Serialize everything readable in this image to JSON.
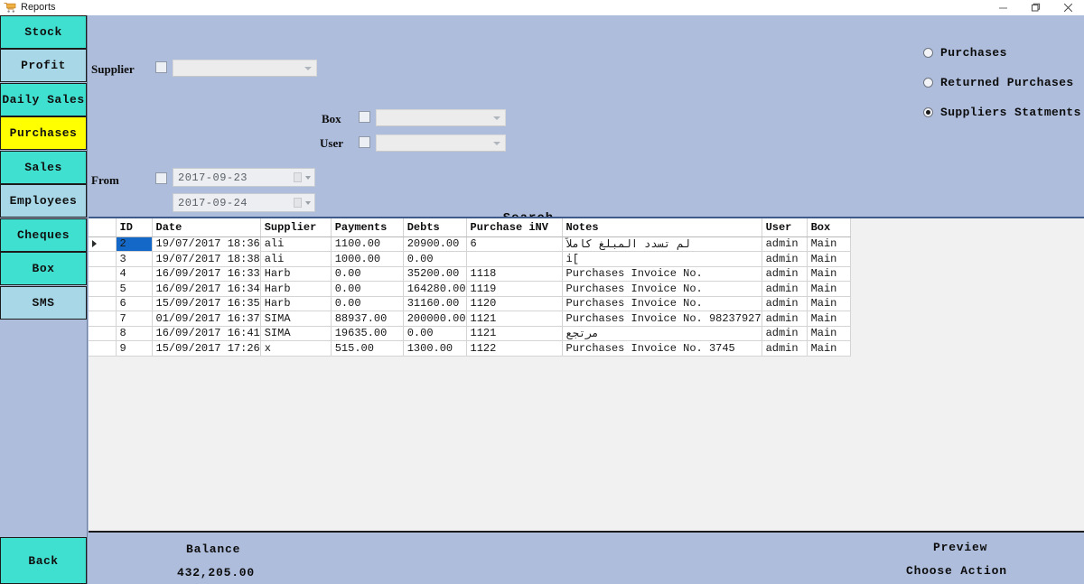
{
  "window": {
    "title": "Reports",
    "icon": "cart-icon",
    "minimize_label": "─",
    "maximize_label": "❐",
    "close_label": "✕"
  },
  "theme": {
    "form_background": "#aebddc",
    "sidebar_teal": "#40e0d0",
    "sidebar_light_blue": "#a8d8e8",
    "sidebar_active_yellow": "#ffff00",
    "grid_selection_blue": "#1468c8",
    "grid_panel_background": "#f1f1f1"
  },
  "sidebar": {
    "items": [
      {
        "label": "Stock",
        "style": "teal",
        "active": false
      },
      {
        "label": "Profit",
        "style": "light",
        "active": false
      },
      {
        "label": "Daily Sales",
        "style": "teal",
        "active": false
      },
      {
        "label": "Purchases",
        "style": "active",
        "active": true
      },
      {
        "label": "Sales",
        "style": "teal",
        "active": false
      },
      {
        "label": "Employees",
        "style": "light",
        "active": false
      },
      {
        "label": "Cheques",
        "style": "teal",
        "active": false
      },
      {
        "label": "Box",
        "style": "teal",
        "active": false
      },
      {
        "label": "SMS",
        "style": "light",
        "active": false
      }
    ],
    "back_label": "Back"
  },
  "filters": {
    "supplier": {
      "label": "Supplier",
      "checked": false,
      "value": "",
      "placeholder": ""
    },
    "box": {
      "label": "Box",
      "checked": false,
      "value": "",
      "placeholder": ""
    },
    "user": {
      "label": "User",
      "checked": false,
      "value": "",
      "placeholder": ""
    },
    "from": {
      "label": "From",
      "checked": false,
      "date_from": "2017-09-23",
      "date_to": "2017-09-24"
    },
    "search_label": "Search"
  },
  "report_type": {
    "options": [
      {
        "label": "Purchases",
        "selected": false
      },
      {
        "label": "Returned Purchases",
        "selected": false
      },
      {
        "label": "Suppliers Statments",
        "selected": true
      }
    ]
  },
  "grid": {
    "columns": [
      "ID",
      "Date",
      "Supplier",
      "Payments",
      "Debts",
      "Purchase iNV",
      "Notes",
      "User",
      "Box"
    ],
    "selected_row_index": 0,
    "rows": [
      {
        "id": "2",
        "date": "19/07/2017 18:36",
        "supplier": "ali",
        "payments": "1100.00",
        "debts": "20900.00",
        "purchase_inv": "6",
        "notes": "لم تسدد المبلغ كاملاً",
        "notes_rtl": true,
        "user": "admin",
        "box": "Main"
      },
      {
        "id": "3",
        "date": "19/07/2017 18:38",
        "supplier": "ali",
        "payments": "1000.00",
        "debts": "0.00",
        "purchase_inv": "",
        "notes": "i[",
        "notes_rtl": false,
        "user": "admin",
        "box": "Main"
      },
      {
        "id": "4",
        "date": "16/09/2017 16:33",
        "supplier": "Harb",
        "payments": "0.00",
        "debts": "35200.00",
        "purchase_inv": "1118",
        "notes": "Purchases Invoice No.",
        "notes_rtl": false,
        "user": "admin",
        "box": "Main"
      },
      {
        "id": "5",
        "date": "16/09/2017 16:34",
        "supplier": "Harb",
        "payments": "0.00",
        "debts": "164280.00",
        "purchase_inv": "1119",
        "notes": "Purchases Invoice No.",
        "notes_rtl": false,
        "user": "admin",
        "box": "Main"
      },
      {
        "id": "6",
        "date": "15/09/2017 16:35",
        "supplier": "Harb",
        "payments": "0.00",
        "debts": "31160.00",
        "purchase_inv": "1120",
        "notes": "Purchases Invoice No.",
        "notes_rtl": false,
        "user": "admin",
        "box": "Main"
      },
      {
        "id": "7",
        "date": "01/09/2017 16:37",
        "supplier": "SIMA",
        "payments": "88937.00",
        "debts": "200000.00",
        "purchase_inv": "1121",
        "notes": "Purchases Invoice No. 98237927",
        "notes_rtl": false,
        "user": "admin",
        "box": "Main"
      },
      {
        "id": "8",
        "date": "16/09/2017 16:41",
        "supplier": "SIMA",
        "payments": "19635.00",
        "debts": "0.00",
        "purchase_inv": "1121",
        "notes": "مرتجع",
        "notes_rtl": true,
        "user": "admin",
        "box": "Main"
      },
      {
        "id": "9",
        "date": "15/09/2017 17:26",
        "supplier": "x",
        "payments": "515.00",
        "debts": "1300.00",
        "purchase_inv": "1122",
        "notes": "Purchases Invoice No. 3745",
        "notes_rtl": false,
        "user": "admin",
        "box": "Main"
      }
    ]
  },
  "footer": {
    "balance_label": "Balance",
    "balance_value": "432,205.00",
    "preview_label": "Preview",
    "choose_action_label": "Choose Action"
  }
}
